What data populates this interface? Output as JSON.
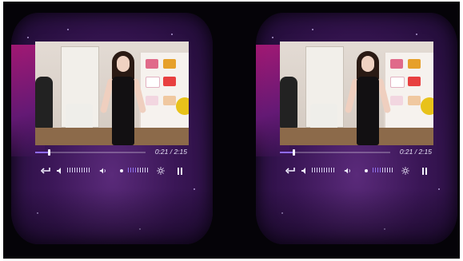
{
  "player": {
    "time_display": "0:21 / 2:15",
    "progress_fraction": 0.12,
    "volume_fraction": 0.55,
    "brightness_fraction": 0.45
  },
  "labels": {
    "back": "back-arrow-icon",
    "volume_down": "volume-down-icon",
    "volume_up": "volume-up-icon",
    "brightness": "brightness-icon",
    "pause": "pause-icon"
  },
  "colors": {
    "accent": "#8f6cff",
    "background": "#3a1656"
  }
}
